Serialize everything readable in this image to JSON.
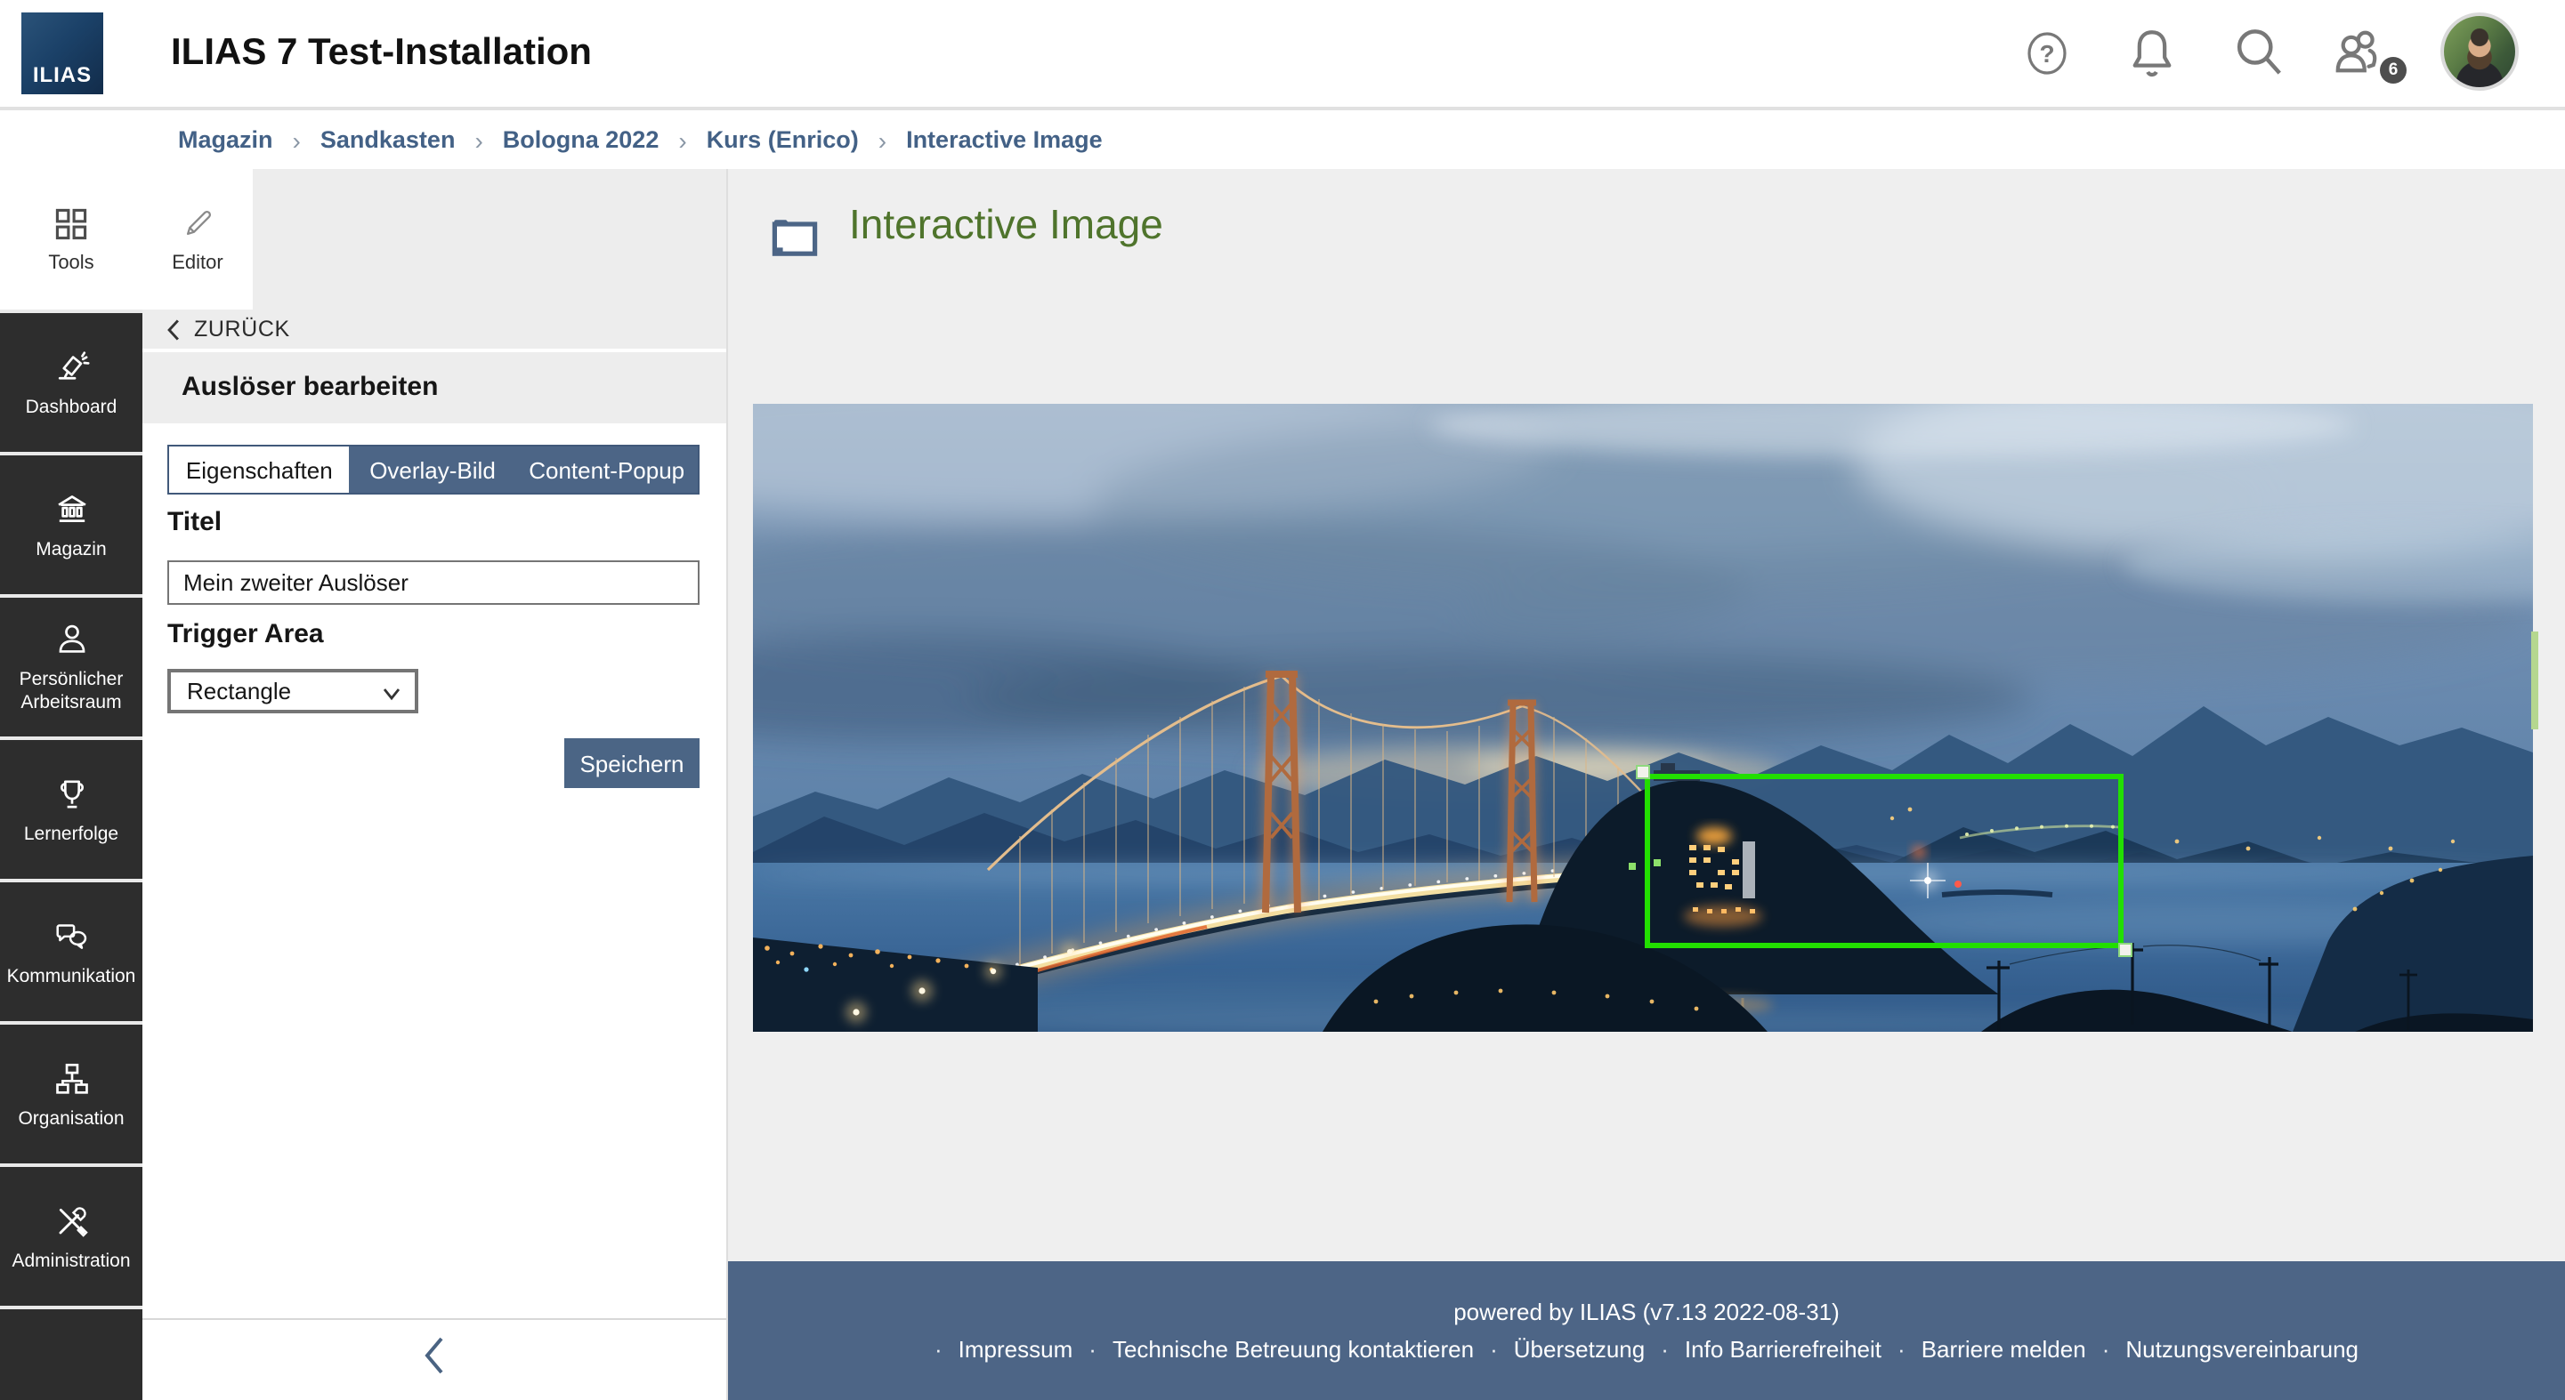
{
  "header": {
    "logo_text": "ILIAS",
    "title": "ILIAS 7 Test-Installation",
    "user_count_badge": "6"
  },
  "breadcrumb": {
    "separator": "›",
    "items": [
      "Magazin",
      "Sandkasten",
      "Bologna 2022",
      "Kurs (Enrico)",
      "Interactive Image"
    ]
  },
  "sidebar": {
    "tools": {
      "label": "Tools",
      "icon": "grid-icon"
    },
    "items": [
      {
        "label": "Dashboard",
        "icon": "lamp-icon"
      },
      {
        "label": "Magazin",
        "icon": "bank-icon"
      },
      {
        "label": "Persönlicher Arbeitsraum",
        "icon": "person-icon"
      },
      {
        "label": "Lernerfolge",
        "icon": "trophy-icon"
      },
      {
        "label": "Kommunikation",
        "icon": "chat-icon"
      },
      {
        "label": "Organisation",
        "icon": "org-chart-icon"
      },
      {
        "label": "Administration",
        "icon": "crossed-tools-icon"
      }
    ]
  },
  "editor_panel": {
    "tool_tab": {
      "label": "Editor",
      "icon": "pencil-icon"
    },
    "back_label": "ZURÜCK",
    "heading": "Auslöser bearbeiten",
    "tabs": [
      {
        "label": "Eigenschaften",
        "active": true
      },
      {
        "label": "Overlay-Bild",
        "active": false
      },
      {
        "label": "Content-Popup",
        "active": false
      }
    ],
    "fields": {
      "titel_label": "Titel",
      "titel_value": "Mein zweiter Auslöser",
      "trigger_area_label": "Trigger Area",
      "trigger_area_value": "Rectangle"
    },
    "save_label": "Speichern"
  },
  "content": {
    "page_title": "Interactive Image",
    "page_icon": "folder-icon"
  },
  "footer": {
    "powered_by": "powered by ILIAS (v7.13 2022-08-31)",
    "separator": "·",
    "links": [
      "Impressum",
      "Technische Betreuung kontaktieren",
      "Übersetzung",
      "Info Barrierefreiheit",
      "Barriere melden",
      "Nutzungsvereinbarung"
    ]
  },
  "colors": {
    "accent_blue": "#4c6586",
    "sidebar_dark": "#2d2d2d",
    "title_green": "#4f742c",
    "annotation_green": "#22df00",
    "logo_navy": "#1b4168"
  }
}
